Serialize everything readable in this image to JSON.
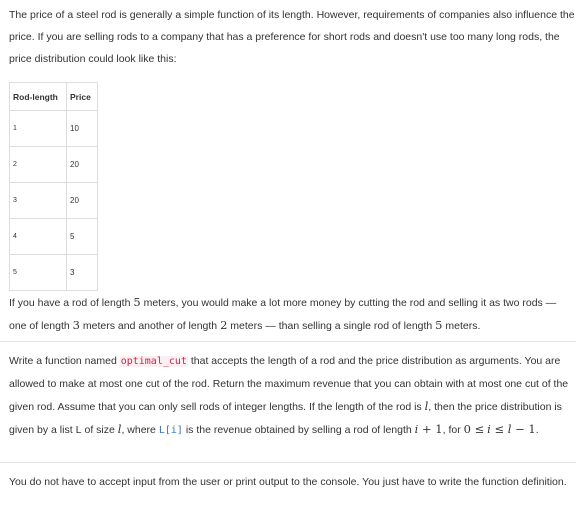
{
  "intro": {
    "text": "The price of a steel rod is generally a simple function of its length. However, requirements of companies also influence the price. If you are selling rods to a company that has a preference for short rods and doesn't use too many long rods, the price distribution could look like this:"
  },
  "table": {
    "headers": [
      "Rod-length",
      "Price"
    ],
    "rows": [
      {
        "length": "1",
        "price": "10"
      },
      {
        "length": "2",
        "price": "20"
      },
      {
        "length": "3",
        "price": "20"
      },
      {
        "length": "4",
        "price": "5"
      },
      {
        "length": "5",
        "price": "3"
      }
    ]
  },
  "after_table": {
    "t1": "If you have a rod of length ",
    "m1": "5",
    "t2": " meters, you would make a lot more money by cutting the rod and selling it as two rods — one of length ",
    "m2": "3",
    "t3": " meters and another of length ",
    "m3": "2",
    "t4": " meters — than selling a single rod of length ",
    "m4": "5",
    "t5": " meters."
  },
  "task": {
    "t1": "Write a function named ",
    "fn": "optimal_cut",
    "t2": " that accepts the length of a rod and the price distribution as arguments. You are allowed to make at most one cut of the rod. Return the maximum revenue that you can obtain with at most one cut of the given rod. Assume that you can only sell rods of integer lengths. If the length of the rod is ",
    "m_l1": "l",
    "t3": ", then the price distribution is given by a list ",
    "code_L": "L",
    "t4": " of size ",
    "m_l2": "l",
    "t5": ", where ",
    "code_Li": "L[i]",
    "t6": " is the revenue obtained by selling a rod of length ",
    "m_i1": "i",
    "m_plus": " + 1",
    "t7": ", for ",
    "m_range_a": "0 ≤",
    "m_range_i": "i",
    "m_range_b": " ≤ ",
    "m_range_l": "l",
    "m_range_c": " − 1",
    "t8": "."
  },
  "note": {
    "text": "You do not have to accept input from the user or print output to the console. You just have to write the function definition."
  }
}
